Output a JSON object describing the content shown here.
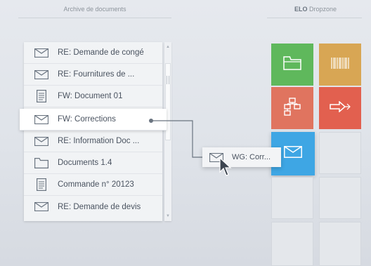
{
  "headers": {
    "left_title": "Archive de documents",
    "right_brand": "ELO",
    "right_title": "Dropzone"
  },
  "document_list": {
    "items": [
      {
        "label": "RE: Demande de congé",
        "icon": "mail-icon"
      },
      {
        "label": "RE: Fournitures de ...",
        "icon": "mail-icon"
      },
      {
        "label": "FW: Document 01",
        "icon": "document-icon"
      },
      {
        "label": "FW: Corrections",
        "icon": "mail-icon",
        "selected": true
      },
      {
        "label": "RE: Information Doc ...",
        "icon": "mail-icon"
      },
      {
        "label": "Documents 1.4",
        "icon": "folder-icon"
      },
      {
        "label": "Commande n° 20123",
        "icon": "document-icon"
      },
      {
        "label": "RE: Demande de devis",
        "icon": "mail-icon"
      }
    ]
  },
  "drag_ghost": {
    "label": "WG: Corr...",
    "icon": "mail-icon"
  },
  "dropzone": {
    "tiles": [
      {
        "name": "folder-tile",
        "icon": "folder-icon",
        "color": "#5fb85c"
      },
      {
        "name": "barcode-tile",
        "icon": "barcode-icon",
        "color": "#d8a654"
      },
      {
        "name": "workflow-tile",
        "icon": "workflow-icon",
        "color": "#e0745f"
      },
      {
        "name": "forward-tile",
        "icon": "forward-arrow-icon",
        "color": "#e2604f"
      },
      {
        "name": "mail-tile",
        "icon": "mail-icon",
        "color": "#3ea6e4"
      },
      {
        "name": "empty-tile",
        "icon": "",
        "color": "#e4e7eb"
      },
      {
        "name": "empty-tile",
        "icon": "",
        "color": "#e4e7eb"
      },
      {
        "name": "empty-tile",
        "icon": "",
        "color": "#e4e7eb"
      },
      {
        "name": "empty-tile",
        "icon": "",
        "color": "#e4e7eb"
      },
      {
        "name": "empty-tile",
        "icon": "",
        "color": "#e4e7eb"
      }
    ]
  }
}
